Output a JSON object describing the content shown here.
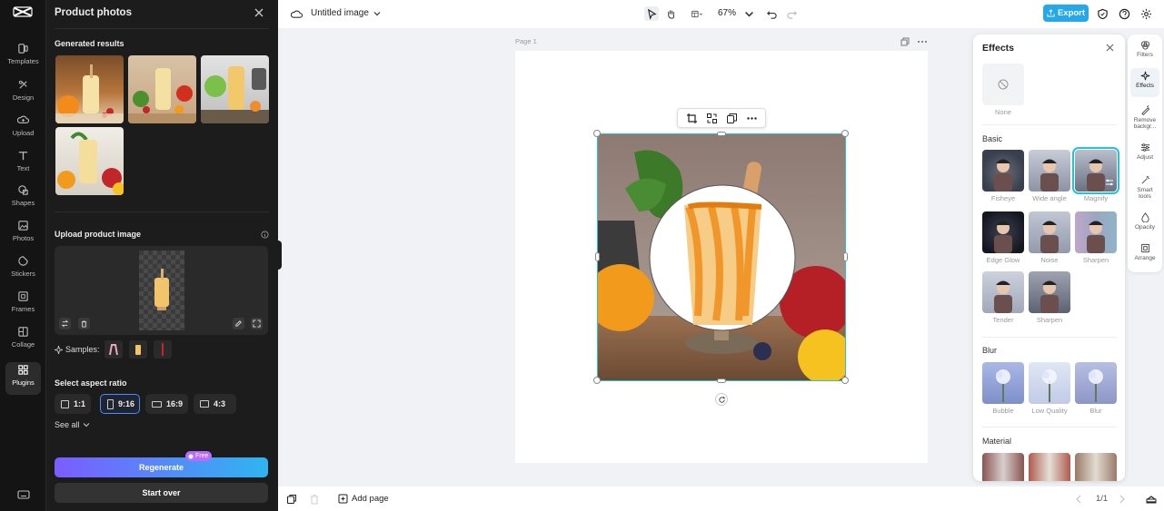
{
  "rail": {
    "items": [
      {
        "label": "Templates",
        "icon": "templates-icon"
      },
      {
        "label": "Design",
        "icon": "design-icon"
      },
      {
        "label": "Upload",
        "icon": "upload-cloud-icon"
      },
      {
        "label": "Text",
        "icon": "text-icon"
      },
      {
        "label": "Shapes",
        "icon": "shapes-icon"
      },
      {
        "label": "Photos",
        "icon": "photos-icon"
      },
      {
        "label": "Stickers",
        "icon": "stickers-icon"
      },
      {
        "label": "Frames",
        "icon": "frames-icon"
      },
      {
        "label": "Collage",
        "icon": "collage-icon"
      },
      {
        "label": "Plugins",
        "icon": "plugins-icon",
        "active": true
      }
    ]
  },
  "panel": {
    "title": "Product photos",
    "generated_label": "Generated results",
    "upload_label": "Upload product image",
    "samples_label": "Samples:",
    "aspect_label": "Select aspect ratio",
    "ratios": [
      "1:1",
      "9:16",
      "16:9",
      "4:3"
    ],
    "selected_ratio": "9:16",
    "see_all": "See all",
    "regenerate": "Regenerate",
    "free_badge": "Free",
    "start_over": "Start over"
  },
  "topbar": {
    "doc_title": "Untitled image",
    "zoom": "67%",
    "export": "Export"
  },
  "canvas": {
    "page_label": "Page 1"
  },
  "bottombar": {
    "add_page": "Add page",
    "pager": "1/1"
  },
  "effects": {
    "title": "Effects",
    "none_label": "None",
    "sections": {
      "basic": "Basic",
      "blur": "Blur",
      "material": "Material"
    },
    "basic": [
      "Fisheye",
      "Wide angle",
      "Magnify",
      "Edge Glow",
      "Noise",
      "Sharpen",
      "Tender",
      "Sharpen"
    ],
    "blur": [
      "Bubble",
      "Low Quality",
      "Blur"
    ],
    "selected": "Magnify"
  },
  "right_rail": {
    "items": [
      {
        "label": "Filters",
        "icon": "filters-icon"
      },
      {
        "label": "Effects",
        "icon": "effects-icon",
        "active": true
      },
      {
        "label": "Remove backgr...",
        "icon": "remove-background-icon"
      },
      {
        "label": "Adjust",
        "icon": "adjust-icon"
      },
      {
        "label": "Smart tools",
        "icon": "smart-tools-icon"
      },
      {
        "label": "Opacity",
        "icon": "opacity-icon"
      },
      {
        "label": "Arrange",
        "icon": "arrange-icon"
      }
    ]
  },
  "colors": {
    "accent": "#22c3d4",
    "export": "#25a8ea",
    "regenerate_start": "#7c5cff",
    "regenerate_end": "#2fb5f0"
  }
}
